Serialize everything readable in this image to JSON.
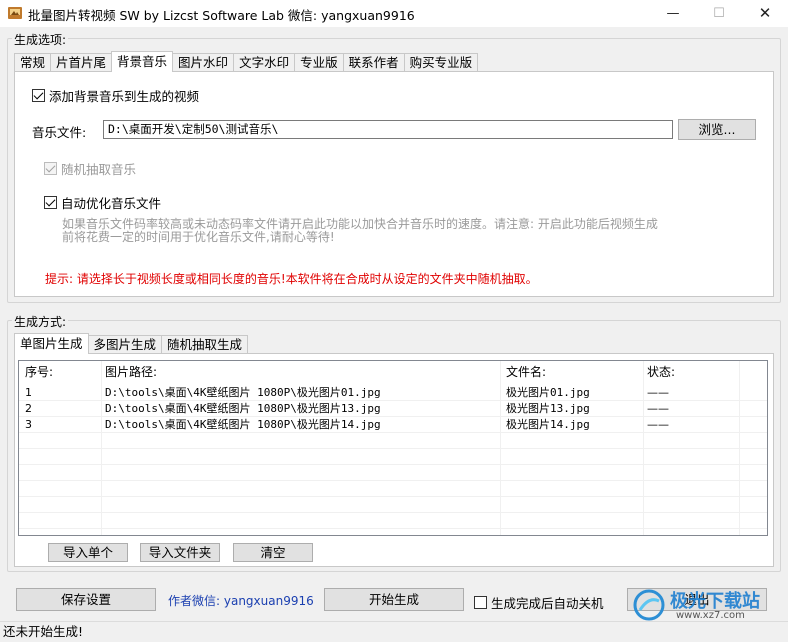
{
  "window": {
    "title": "批量图片转视频 SW  by Lizcst Software Lab  微信: yangxuan9916",
    "minimize": "—",
    "maximize": "☐",
    "close": "✕"
  },
  "options_group": {
    "label": "生成选项:",
    "tabs": [
      "常规",
      "片首片尾",
      "背景音乐",
      "图片水印",
      "文字水印",
      "专业版",
      "联系作者",
      "购买专业版"
    ],
    "active_tab": "背景音乐"
  },
  "music": {
    "add_music_label": "添加背景音乐到生成的视频",
    "add_music_checked": true,
    "file_label": "音乐文件:",
    "file_value": "D:\\桌面开发\\定制50\\测试音乐\\",
    "browse_label": "浏览...",
    "random_label": "随机抽取音乐",
    "random_checked": true,
    "random_disabled": true,
    "optimize_label": "自动优化音乐文件",
    "optimize_checked": true,
    "optimize_desc_line1": "如果音乐文件码率较高或未动态码率文件请开启此功能以加快合并音乐时的速度。请注意: 开启此功能后视频生成",
    "optimize_desc_line2": "前将花费一定的时间用于优化音乐文件,请耐心等待!",
    "tip": "提示: 请选择长于视频长度或相同长度的音乐!本软件将在合成时从设定的文件夹中随机抽取。",
    "tip_color": "#e00000"
  },
  "mode_group": {
    "label": "生成方式:",
    "tabs": [
      "单图片生成",
      "多图片生成",
      "随机抽取生成"
    ],
    "active_tab": "单图片生成"
  },
  "table": {
    "columns": [
      "序号:",
      "图片路径:",
      "文件名:",
      "状态:"
    ],
    "rows": [
      {
        "index": "1",
        "path": "D:\\tools\\桌面\\4K壁纸图片 1080P\\极光图片01.jpg",
        "name": "极光图片01.jpg",
        "status": "——"
      },
      {
        "index": "2",
        "path": "D:\\tools\\桌面\\4K壁纸图片 1080P\\极光图片13.jpg",
        "name": "极光图片13.jpg",
        "status": "——"
      },
      {
        "index": "3",
        "path": "D:\\tools\\桌面\\4K壁纸图片 1080P\\极光图片14.jpg",
        "name": "极光图片14.jpg",
        "status": "——"
      }
    ]
  },
  "list_buttons": {
    "import_single": "导入单个",
    "import_folder": "导入文件夹",
    "clear": "清空"
  },
  "bottom": {
    "save_settings": "保存设置",
    "author_wechat": "作者微信: yangxuan9916",
    "author_color": "#1a3fb0",
    "start": "开始生成",
    "auto_shutdown_label": "生成完成后自动关机",
    "auto_shutdown_checked": false,
    "exit": "退出"
  },
  "status": {
    "text": "还未开始生成!"
  },
  "watermark": {
    "text_main": "极光下载站",
    "text_url": "www.xz7.com"
  }
}
